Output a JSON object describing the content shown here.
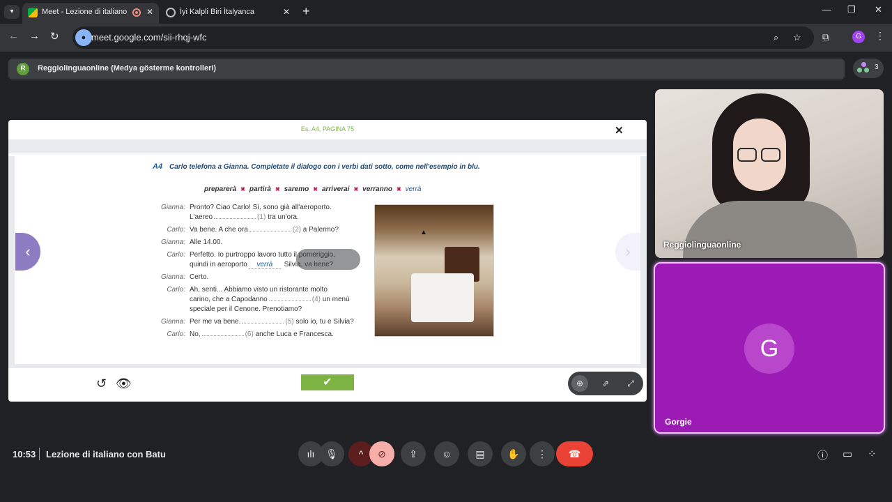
{
  "browser": {
    "tabs": [
      {
        "title": "Meet - Lezione di italiano con Batu",
        "active": true
      },
      {
        "title": "İyi Kalpli Biri İtalyanca",
        "active": false
      }
    ],
    "url": "meet.google.com/sii-rhqj-wfc",
    "profile_initial": "G",
    "icons": {
      "tab_list": "chevron-down-icon",
      "new_tab": "plus-icon",
      "minimize": "minimize-icon",
      "restore": "restore-icon",
      "close": "close-icon",
      "back": "arrow-left-icon",
      "forward": "arrow-right-icon",
      "reload": "reload-icon",
      "zoom": "magnifier-icon",
      "bookmark": "star-icon",
      "extensions": "puzzle-icon",
      "menu": "kebab-icon"
    }
  },
  "meet": {
    "presenter_initial": "R",
    "presenter_label": "Reggiolinguaonline (Medya gösterme kontrolleri)",
    "participant_count": "3",
    "time": "10:53",
    "meeting_title": "Lezione di italiano con Batu",
    "participants": [
      {
        "name": "Reggiolinguaonline"
      },
      {
        "name": "Gorgie",
        "initial": "G"
      }
    ],
    "accent_colors": {
      "tile": "#9c1bb4",
      "leave": "#ea4335",
      "avatar": "#b847cc"
    }
  },
  "exercise": {
    "header": "Es. A4, PAGINA 75",
    "task_number": "A4",
    "task_text": "Carlo telefona a Gianna. Completate il dialogo con i verbi dati sotto, come nell'esempio in blu.",
    "verbs": [
      "preparerà",
      "partirà",
      "saremo",
      "arriverai",
      "verranno",
      "verrà"
    ],
    "dialogue": {
      "l1_speaker": "Gianna:",
      "l1_text": "Pronto? Ciao Carlo! Sì, sono già all'aeroporto.",
      "l2_text_a": "L'aereo",
      "l2_num": "(1)",
      "l2_text_b": "tra un'ora.",
      "l3_speaker": "Carlo:",
      "l3_text_a": "Va bene. A che ora",
      "l3_num": "(2)",
      "l3_text_b": "a Palermo?",
      "l4_speaker": "Gianna:",
      "l4_text": "Alle 14.00.",
      "l5_speaker": "Carlo:",
      "l5_text": "Perfetto. Io purtroppo lavoro tutto il pomeriggio,",
      "l6_text_a": "quindi in aeroporto",
      "l6_answer": "verrà",
      "l6_text_b": "Silvia, va bene?",
      "l7_speaker": "Gianna:",
      "l7_text": "Certo.",
      "l8_speaker": "Carlo:",
      "l8_text": "Ah, senti... Abbiamo visto un ristorante molto",
      "l9_text_a": "carino, che a Capodanno",
      "l9_num": "(4)",
      "l9_text_b": "un menù",
      "l10_text": "speciale per il Cenone. Prenotiamo?",
      "l11_speaker": "Gianna:",
      "l11_text_a": "Per me va bene.",
      "l11_num": "(5)",
      "l11_text_b": "solo io, tu e Silvia?",
      "l12_speaker": "Carlo:",
      "l12_text_a": "No,",
      "l12_num": "(6)",
      "l12_text_b": "anche Luca e Francesca."
    },
    "controls": {
      "reset": "reset-icon",
      "show_answers": "eye-icon",
      "check": "checkmark-icon",
      "zoom": "zoom-in-icon",
      "open_external": "external-link-icon",
      "fullscreen": "fullscreen-icon"
    }
  },
  "call_controls": [
    "audio-levels-icon",
    "mic-icon",
    "chevron-up-icon",
    "camera-off-icon",
    "present-icon",
    "emoji-icon",
    "captions-icon",
    "raise-hand-icon",
    "more-options-icon",
    "leave-call-icon"
  ],
  "side_controls": [
    "info-icon",
    "chat-icon",
    "activities-icon"
  ]
}
